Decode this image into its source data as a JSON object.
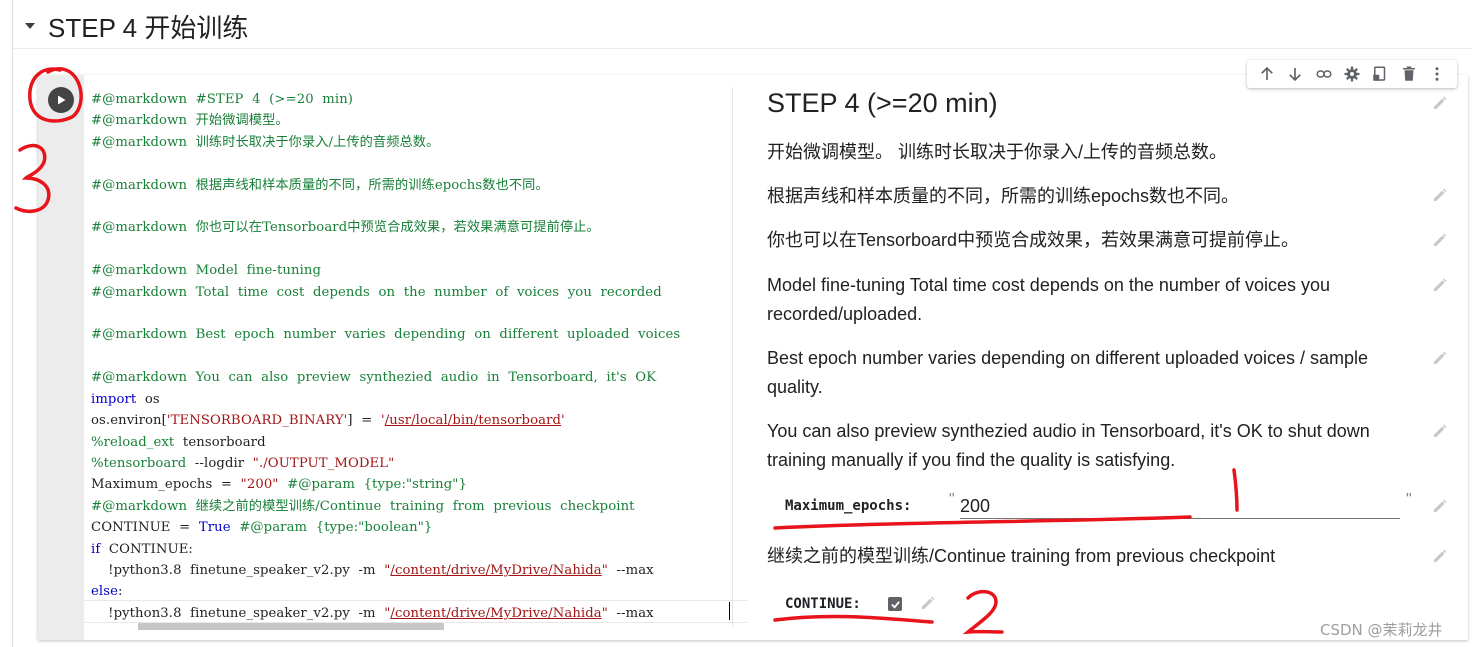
{
  "section": {
    "title": "STEP 4 开始训练"
  },
  "code_lines": [
    [
      {
        "t": "#@markdown  #STEP  4  (>=20  min)",
        "c": "c"
      }
    ],
    [
      {
        "t": "#@markdown  开始微调模型。",
        "c": "c"
      }
    ],
    [
      {
        "t": "#@markdown  训练时长取决于你录入/上传的音频总数。",
        "c": "c"
      }
    ],
    [],
    [
      {
        "t": "#@markdown  根据声线和样本质量的不同，所需的训练epochs数也不同。",
        "c": "c"
      }
    ],
    [],
    [
      {
        "t": "#@markdown  你也可以在Tensorboard中预览合成效果，若效果满意可提前停止。",
        "c": "c"
      }
    ],
    [],
    [
      {
        "t": "#@markdown  Model  fine-tuning",
        "c": "c"
      }
    ],
    [
      {
        "t": "#@markdown  Total  time  cost  depends  on  the  number  of  voices  you  recorded",
        "c": "c"
      }
    ],
    [],
    [
      {
        "t": "#@markdown  Best  epoch  number  varies  depending  on  different  uploaded  voices",
        "c": "c"
      }
    ],
    [],
    [
      {
        "t": "#@markdown  You  can  also  preview  synthezied  audio  in  Tensorboard,  it's  OK",
        "c": "c"
      }
    ],
    [
      {
        "t": "import",
        "c": "kw"
      },
      {
        "t": "  os",
        "c": ""
      }
    ],
    [
      {
        "t": "os.environ[",
        "c": ""
      },
      {
        "t": "'TENSORBOARD_BINARY'",
        "c": "s"
      },
      {
        "t": "]  =  ",
        "c": ""
      },
      {
        "t": "'",
        "c": "s"
      },
      {
        "t": "/usr/local/bin/tensorboard",
        "c": "u"
      },
      {
        "t": "'",
        "c": "s"
      }
    ],
    [
      {
        "t": "%reload_ext",
        "c": "c"
      },
      {
        "t": "  tensorboard",
        "c": ""
      }
    ],
    [
      {
        "t": "%tensorboard",
        "c": "c"
      },
      {
        "t": "  --logdir  ",
        "c": ""
      },
      {
        "t": "\"./OUTPUT_MODEL\"",
        "c": "s"
      }
    ],
    [
      {
        "t": "Maximum_epochs  =  ",
        "c": ""
      },
      {
        "t": "\"200\"",
        "c": "s"
      },
      {
        "t": "  #@param  {type:\"string\"}",
        "c": "c"
      }
    ],
    [
      {
        "t": "#@markdown  继续之前的模型训练/Continue  training  from  previous  checkpoint",
        "c": "c"
      }
    ],
    [
      {
        "t": "CONTINUE  =  ",
        "c": ""
      },
      {
        "t": "True",
        "c": "kw"
      },
      {
        "t": "  #@param  {type:\"boolean\"}",
        "c": "c"
      }
    ],
    [
      {
        "t": "if",
        "c": "kw"
      },
      {
        "t": "  CONTINUE:",
        "c": ""
      }
    ],
    [
      {
        "t": "    !python3.8  finetune_speaker_v2.py  -m  ",
        "c": ""
      },
      {
        "t": "\"",
        "c": "s"
      },
      {
        "t": "/content/drive/MyDrive/Nahida",
        "c": "u"
      },
      {
        "t": "\"",
        "c": "s"
      },
      {
        "t": "  --max",
        "c": ""
      }
    ],
    [
      {
        "t": "else",
        "c": "kw"
      },
      {
        "t": ":",
        "c": ""
      }
    ],
    [
      {
        "t": "    !python3.8  finetune_speaker_v2.py  -m  ",
        "c": ""
      },
      {
        "t": "\"",
        "c": "s"
      },
      {
        "t": "/content/drive/MyDrive/Nahida",
        "c": "u"
      },
      {
        "t": "\"",
        "c": "s"
      },
      {
        "t": "  --max",
        "c": ""
      }
    ]
  ],
  "form": {
    "title": "STEP 4 (>=20 min)",
    "paragraphs": [
      "开始微调模型。 训练时长取决于你录入/上传的音频总数。",
      "根据声线和样本质量的不同，所需的训练epochs数也不同。",
      "你也可以在Tensorboard中预览合成效果，若效果满意可提前停止。",
      "Model fine-tuning Total time cost depends on the number of voices you recorded/uploaded.",
      "Best epoch number varies depending on different uploaded voices / sample quality.",
      "You can also preview synthezied audio in Tensorboard, it's OK to shut down training manually if you find the quality is satisfying."
    ],
    "max_epochs_label": "Maximum_epochs:",
    "max_epochs_value": "200",
    "quote_open": "\"",
    "quote_close": "\"",
    "continue_heading": "继续之前的模型训练/Continue training from previous checkpoint",
    "continue_label": "CONTINUE:",
    "continue_checked": true
  },
  "toolbar_icons": [
    "arrow-up-icon",
    "arrow-down-icon",
    "link-icon",
    "gear-icon",
    "mirror-cell-icon",
    "trash-icon",
    "more-vert-icon"
  ],
  "watermark": "CSDN @茉莉龙井",
  "annotation_color": "#e8141c"
}
